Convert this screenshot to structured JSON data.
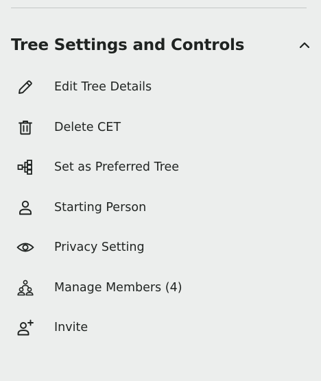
{
  "section": {
    "title": "Tree Settings and Controls",
    "toggle_icon": "chevron-up-icon"
  },
  "menu": {
    "items": [
      {
        "label": "Edit Tree Details",
        "icon": "pencil-icon"
      },
      {
        "label": "Delete CET",
        "icon": "trash-icon"
      },
      {
        "label": "Set as Preferred Tree",
        "icon": "tree-structure-icon"
      },
      {
        "label": "Starting Person",
        "icon": "person-icon"
      },
      {
        "label": "Privacy Setting",
        "icon": "eye-icon"
      },
      {
        "label": "Manage Members (4)",
        "icon": "group-icon"
      },
      {
        "label": "Invite",
        "icon": "person-add-icon"
      }
    ]
  },
  "colors": {
    "background": "#eceeed",
    "text": "#1f2321",
    "divider": "#c4c7c6"
  }
}
